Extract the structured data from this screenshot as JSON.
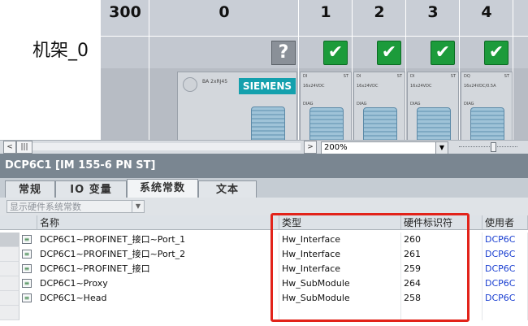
{
  "device_view": {
    "rack_name": "机架_0",
    "slots": [
      {
        "label": "300"
      },
      {
        "label": "0"
      },
      {
        "label": "1"
      },
      {
        "label": "2"
      },
      {
        "label": "3"
      },
      {
        "label": "4"
      }
    ],
    "brand": "SIEMENS",
    "modules": [
      {
        "type": "DI",
        "st": "ST",
        "spec": "16x24VDC",
        "diag": "DIAG"
      },
      {
        "type": "DI",
        "st": "ST",
        "spec": "16x24VDC",
        "diag": "DIAG"
      },
      {
        "type": "DI",
        "st": "ST",
        "spec": "16x24VDC",
        "diag": "DIAG"
      },
      {
        "type": "DQ",
        "st": "ST",
        "spec": "16x24VDC/0.5A",
        "diag": "DIAG"
      }
    ],
    "head_module_label": "BA 2xRJ45"
  },
  "zoom": {
    "value": "200%"
  },
  "panel": {
    "title": "DCP6C1 [IM 155-6 PN ST]"
  },
  "tabs": [
    {
      "label": "常规"
    },
    {
      "label": "IO 变量"
    },
    {
      "label": "系统常数"
    },
    {
      "label": "文本"
    }
  ],
  "filter": {
    "value": "显示硬件系统常数"
  },
  "table": {
    "headers": {
      "name": "名称",
      "type": "类型",
      "hwid": "硬件标识符",
      "user": "使用者"
    },
    "rows": [
      {
        "name": "DCP6C1~PROFINET_接口~Port_1",
        "type": "Hw_Interface",
        "hwid": "260",
        "user": "DCP6C"
      },
      {
        "name": "DCP6C1~PROFINET_接口~Port_2",
        "type": "Hw_Interface",
        "hwid": "261",
        "user": "DCP6C"
      },
      {
        "name": "DCP6C1~PROFINET_接口",
        "type": "Hw_Interface",
        "hwid": "259",
        "user": "DCP6C"
      },
      {
        "name": "DCP6C1~Proxy",
        "type": "Hw_SubModule",
        "hwid": "264",
        "user": "DCP6C"
      },
      {
        "name": "DCP6C1~Head",
        "type": "Hw_SubModule",
        "hwid": "258",
        "user": "DCP6C"
      }
    ]
  },
  "colors": {
    "highlight": "#e2231a",
    "user_link": "#1a3fd1",
    "ok_green": "#1c9b3b",
    "brand_teal": "#14a0ad"
  }
}
